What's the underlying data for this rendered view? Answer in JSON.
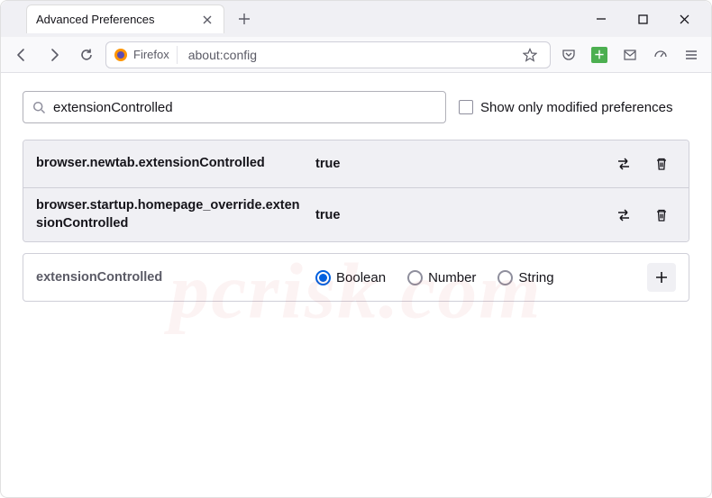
{
  "tab": {
    "title": "Advanced Preferences"
  },
  "urlbar": {
    "identity_label": "Firefox",
    "url": "about:config"
  },
  "search": {
    "value": "extensionControlled",
    "checkbox_label": "Show only modified preferences"
  },
  "results": [
    {
      "name": "browser.newtab.extensionControlled",
      "value": "true"
    },
    {
      "name": "browser.startup.homepage_override.extensionControlled",
      "value": "true"
    }
  ],
  "add_new": {
    "name": "extensionControlled",
    "types": [
      "Boolean",
      "Number",
      "String"
    ],
    "selected": "Boolean"
  },
  "watermark": {
    "line1": "pcrisk.com"
  }
}
